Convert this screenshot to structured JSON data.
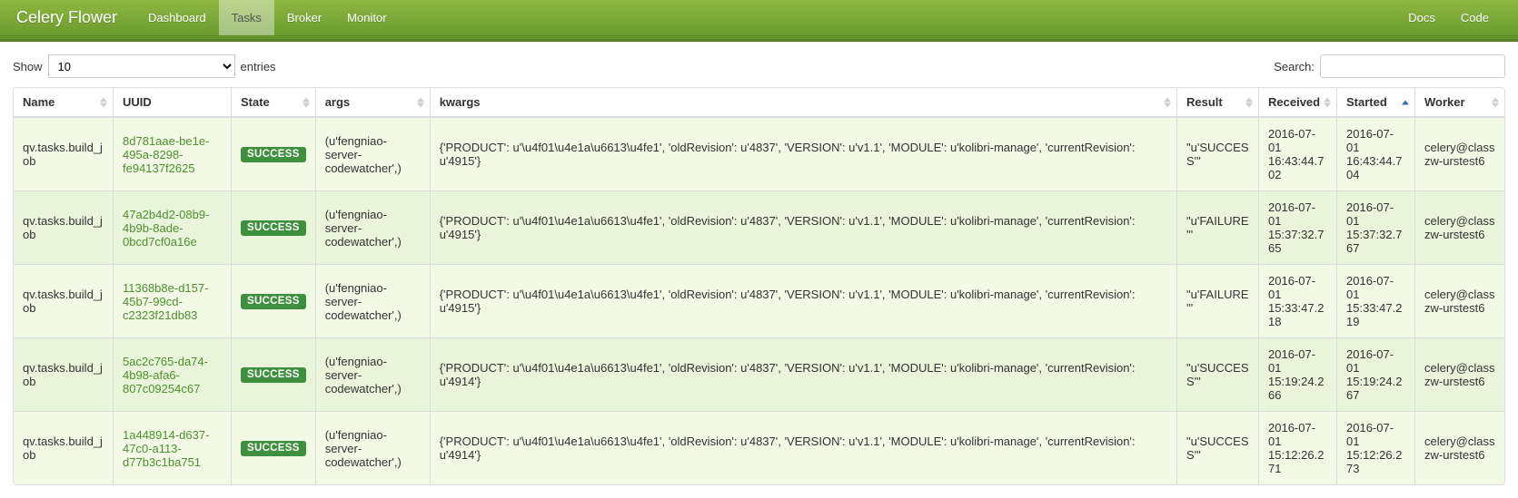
{
  "navbar": {
    "brand": "Celery Flower",
    "left": [
      {
        "label": "Dashboard",
        "active": false
      },
      {
        "label": "Tasks",
        "active": true
      },
      {
        "label": "Broker",
        "active": false
      },
      {
        "label": "Monitor",
        "active": false
      }
    ],
    "right": [
      {
        "label": "Docs"
      },
      {
        "label": "Code"
      }
    ]
  },
  "controls": {
    "show_label": "Show",
    "entries_label": "entries",
    "page_length": "10",
    "search_label": "Search:",
    "search_value": ""
  },
  "columns": [
    {
      "label": "Name",
      "sortable": true
    },
    {
      "label": "UUID",
      "sortable": false
    },
    {
      "label": "State",
      "sortable": true
    },
    {
      "label": "args",
      "sortable": true
    },
    {
      "label": "kwargs",
      "sortable": true
    },
    {
      "label": "Result",
      "sortable": true
    },
    {
      "label": "Received",
      "sortable": true
    },
    {
      "label": "Started",
      "sortable": true,
      "sorted_asc": true
    },
    {
      "label": "Worker",
      "sortable": true
    }
  ],
  "rows": [
    {
      "name": "qv.tasks.build_job",
      "uuid": "8d781aae-be1e-495a-8298-fe94137f2625",
      "state": "SUCCESS",
      "args": "(u'fengniao-server-codewatcher',)",
      "kwargs": "{'PRODUCT': u'\\u4f01\\u4e1a\\u6613\\u4fe1', 'oldRevision': u'4837', 'VERSION': u'v1.1', 'MODULE': u'kolibri-manage', 'currentRevision': u'4915'}",
      "result": "\"u'SUCCESS'\"",
      "received": "2016-07-01 16:43:44.702",
      "started": "2016-07-01 16:43:44.704",
      "worker": "celery@classzw-urstest6"
    },
    {
      "name": "qv.tasks.build_job",
      "uuid": "47a2b4d2-08b9-4b9b-8ade-0bcd7cf0a16e",
      "state": "SUCCESS",
      "args": "(u'fengniao-server-codewatcher',)",
      "kwargs": "{'PRODUCT': u'\\u4f01\\u4e1a\\u6613\\u4fe1', 'oldRevision': u'4837', 'VERSION': u'v1.1', 'MODULE': u'kolibri-manage', 'currentRevision': u'4915'}",
      "result": "\"u'FAILURE'\"",
      "received": "2016-07-01 15:37:32.765",
      "started": "2016-07-01 15:37:32.767",
      "worker": "celery@classzw-urstest6"
    },
    {
      "name": "qv.tasks.build_job",
      "uuid": "11368b8e-d157-45b7-99cd-c2323f21db83",
      "state": "SUCCESS",
      "args": "(u'fengniao-server-codewatcher',)",
      "kwargs": "{'PRODUCT': u'\\u4f01\\u4e1a\\u6613\\u4fe1', 'oldRevision': u'4837', 'VERSION': u'v1.1', 'MODULE': u'kolibri-manage', 'currentRevision': u'4915'}",
      "result": "\"u'FAILURE'\"",
      "received": "2016-07-01 15:33:47.218",
      "started": "2016-07-01 15:33:47.219",
      "worker": "celery@classzw-urstest6"
    },
    {
      "name": "qv.tasks.build_job",
      "uuid": "5ac2c765-da74-4b98-afa6-807c09254c67",
      "state": "SUCCESS",
      "args": "(u'fengniao-server-codewatcher',)",
      "kwargs": "{'PRODUCT': u'\\u4f01\\u4e1a\\u6613\\u4fe1', 'oldRevision': u'4837', 'VERSION': u'v1.1', 'MODULE': u'kolibri-manage', 'currentRevision': u'4914'}",
      "result": "\"u'SUCCESS'\"",
      "received": "2016-07-01 15:19:24.266",
      "started": "2016-07-01 15:19:24.267",
      "worker": "celery@classzw-urstest6"
    },
    {
      "name": "qv.tasks.build_job",
      "uuid": "1a448914-d637-47c0-a113-d77b3c1ba751",
      "state": "SUCCESS",
      "args": "(u'fengniao-server-codewatcher',)",
      "kwargs": "{'PRODUCT': u'\\u4f01\\u4e1a\\u6613\\u4fe1', 'oldRevision': u'4837', 'VERSION': u'v1.1', 'MODULE': u'kolibri-manage', 'currentRevision': u'4914'}",
      "result": "\"u'SUCCESS'\"",
      "received": "2016-07-01 15:12:26.271",
      "started": "2016-07-01 15:12:26.273",
      "worker": "celery@classzw-urstest6"
    }
  ]
}
